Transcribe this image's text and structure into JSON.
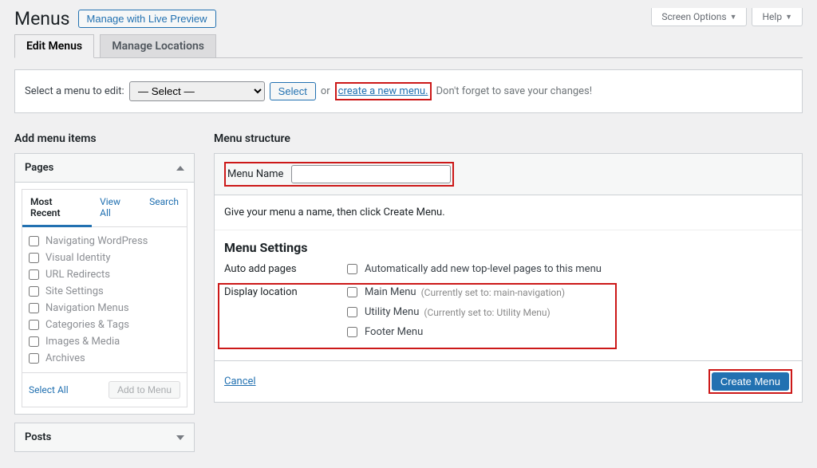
{
  "header": {
    "title": "Menus",
    "previewBtn": "Manage with Live Preview",
    "screenOptions": "Screen Options",
    "help": "Help"
  },
  "tabs": {
    "edit": "Edit Menus",
    "locations": "Manage Locations"
  },
  "selectRow": {
    "label": "Select a menu to edit:",
    "selectOption": "— Select —",
    "selectBtn": "Select",
    "or": "or",
    "createLink": "create a new menu.",
    "reminder": "Don't forget to save your changes!"
  },
  "leftCol": {
    "heading": "Add menu items",
    "pagesTitle": "Pages",
    "innerTabs": {
      "recent": "Most Recent",
      "viewAll": "View All",
      "search": "Search"
    },
    "pages": [
      "Navigating WordPress",
      "Visual Identity",
      "URL Redirects",
      "Site Settings",
      "Navigation Menus",
      "Categories & Tags",
      "Images & Media",
      "Archives"
    ],
    "selectAll": "Select All",
    "addToMenu": "Add to Menu",
    "postsTitle": "Posts"
  },
  "rightCol": {
    "heading": "Menu structure",
    "menuNameLabel": "Menu Name",
    "hint": "Give your menu a name, then click Create Menu.",
    "settingsTitle": "Menu Settings",
    "autoAddLabel": "Auto add pages",
    "autoAddOpt": "Automatically add new top-level pages to this menu",
    "displayLocLabel": "Display location",
    "locations": [
      {
        "label": "Main Menu",
        "hint": "(Currently set to: main-navigation)"
      },
      {
        "label": "Utility Menu",
        "hint": "(Currently set to: Utility Menu)"
      },
      {
        "label": "Footer Menu",
        "hint": ""
      }
    ],
    "cancel": "Cancel",
    "createMenu": "Create Menu"
  }
}
